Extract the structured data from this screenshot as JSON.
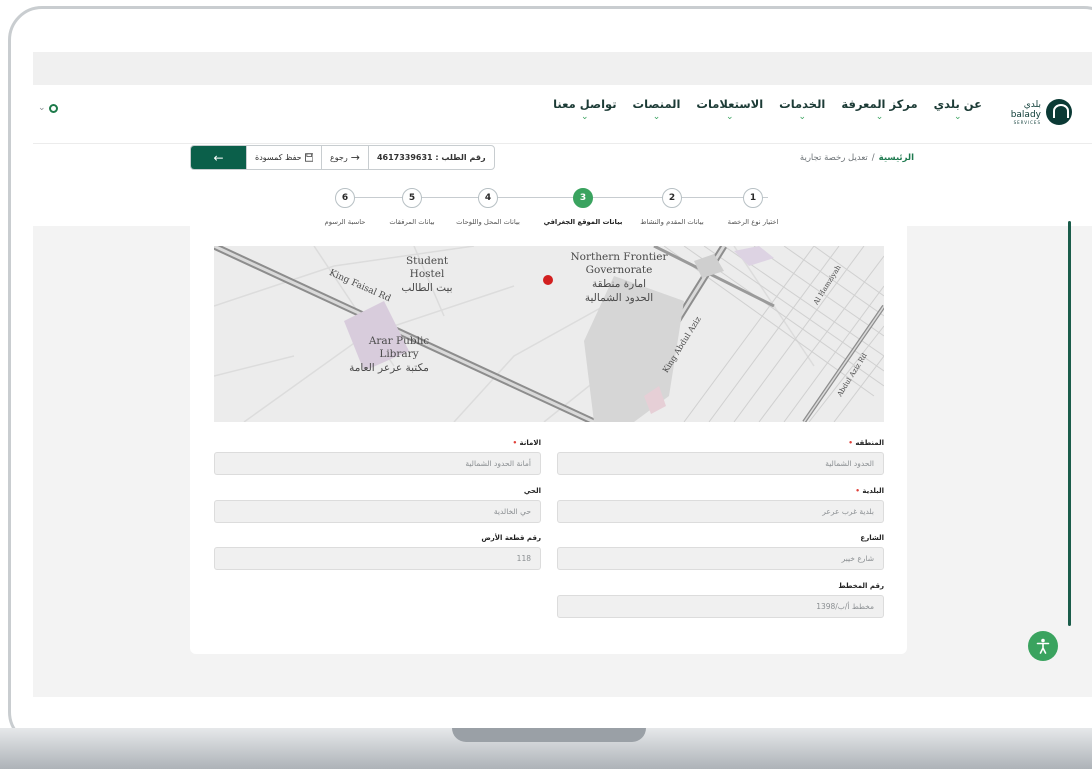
{
  "colors": {
    "brand": "#0b5f4a",
    "accent": "#3aa35f",
    "required": "#e0413a"
  },
  "logo": {
    "arabic": "بلدي",
    "latin": "balady",
    "sub": "SERVICES"
  },
  "nav": {
    "items": [
      {
        "label": "عن بلدي"
      },
      {
        "label": "مركز المعرفة"
      },
      {
        "label": "الخدمات"
      },
      {
        "label": "الاستعلامات"
      },
      {
        "label": "المنصات"
      },
      {
        "label": "تواصل معنا"
      }
    ],
    "chevron": "⌄",
    "left_icon": "location-icon"
  },
  "breadcrumb": {
    "home": "الرئيسية",
    "sep": "/",
    "current": "تعديل رخصة تجارية"
  },
  "actions": {
    "order_label": "رقم الطلب : 4617339631",
    "back_label": "رجوع",
    "draft_label": "حفظ كمسودة",
    "forward_icon": "←",
    "back_icon": "→"
  },
  "steps": [
    {
      "num": "1",
      "label": "اختيار نوع الرخصة"
    },
    {
      "num": "2",
      "label": "بيانات المقدم والنشاط"
    },
    {
      "num": "3",
      "label": "بيانات الموقع الجغرافي",
      "active": true
    },
    {
      "num": "4",
      "label": "بيانات المحل واللوحات"
    },
    {
      "num": "5",
      "label": "بيانات المرفقات"
    },
    {
      "num": "6",
      "label": "حاسبة الرسوم"
    }
  ],
  "map": {
    "labels": [
      "Student",
      "Hostel",
      "بيت الطالب",
      "Northern Frontier",
      "Governorate",
      "امارة منطقة",
      "الحدود الشمالية",
      "Arar Public",
      "Library",
      "مكتبة عرعر العامة",
      "King Faisal Rd",
      "King Abdul Aziz",
      "Al Hamziyah",
      "Abdul Aziz Rd"
    ]
  },
  "form": {
    "region": {
      "label": "المنطقه",
      "value": "الحدود الشمالية"
    },
    "amanah": {
      "label": "الامانة",
      "value": "أمانة الحدود الشمالية"
    },
    "municipality": {
      "label": "البلدية",
      "value": "بلدية غرب عرعر"
    },
    "district": {
      "label": "الحي",
      "value": "حي الخالدية"
    },
    "street": {
      "label": "الشارع",
      "value": "شارع خيبر"
    },
    "parcel": {
      "label": "رقم قطعة الأرض",
      "value": "118"
    },
    "plan": {
      "label": "رقم المخطط",
      "value": "مخطط أ/ب/1398"
    }
  },
  "a11y_icon": "accessibility-icon"
}
